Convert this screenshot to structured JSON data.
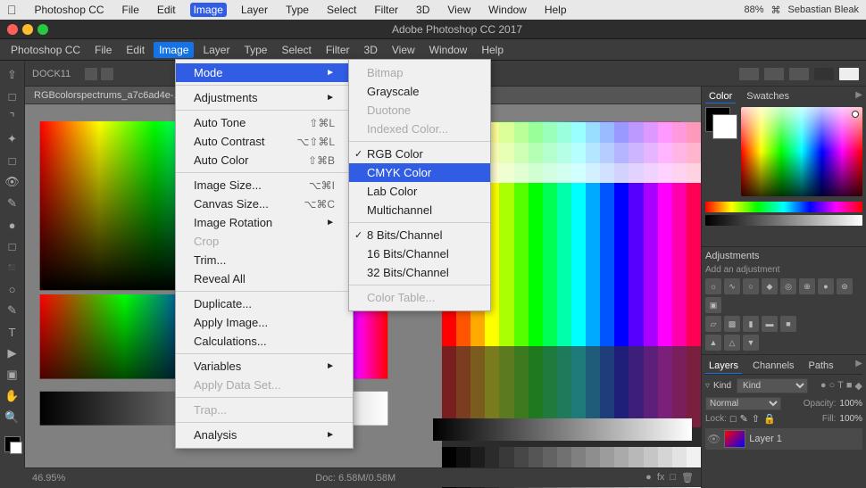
{
  "os": {
    "menubar": {
      "apple": "⌘",
      "items": [
        "Photoshop CC",
        "File",
        "Edit",
        "Image",
        "Layer",
        "Type",
        "Select",
        "Filter",
        "3D",
        "View",
        "Window",
        "Help"
      ],
      "active_item": "Image",
      "right": {
        "battery": "88%",
        "wifi": "WiFi",
        "user": "Sebastian Bleak",
        "time": ""
      }
    }
  },
  "ps": {
    "title": "Adobe Photoshop CC 2017",
    "tab": "RGBcolorspectrums_a7c6ad4e-...",
    "zoom": "46.95%",
    "doc_size": "Doc: 6.58M/0.58M",
    "options_bar": {
      "dock_label": "DOCK11"
    }
  },
  "image_menu": {
    "items": [
      {
        "label": "Mode",
        "shortcut": "",
        "has_submenu": true,
        "highlighted": true
      },
      {
        "separator": true
      },
      {
        "label": "Adjustments",
        "shortcut": "",
        "has_submenu": true
      },
      {
        "separator": true
      },
      {
        "label": "Auto Tone",
        "shortcut": "⇧⌘L"
      },
      {
        "label": "Auto Contrast",
        "shortcut": "⌥⇧⌘L"
      },
      {
        "label": "Auto Color",
        "shortcut": "⇧⌘B"
      },
      {
        "separator": true
      },
      {
        "label": "Image Size...",
        "shortcut": "⌥⌘I"
      },
      {
        "label": "Canvas Size...",
        "shortcut": "⌥⌘C"
      },
      {
        "label": "Image Rotation",
        "shortcut": "",
        "has_submenu": true
      },
      {
        "label": "Crop",
        "shortcut": "",
        "disabled": true
      },
      {
        "label": "Trim...",
        "shortcut": ""
      },
      {
        "label": "Reveal All",
        "shortcut": ""
      },
      {
        "separator": true
      },
      {
        "label": "Duplicate...",
        "shortcut": ""
      },
      {
        "label": "Apply Image...",
        "shortcut": ""
      },
      {
        "label": "Calculations...",
        "shortcut": ""
      },
      {
        "separator": true
      },
      {
        "label": "Variables",
        "shortcut": "",
        "has_submenu": true
      },
      {
        "label": "Apply Data Set...",
        "shortcut": "",
        "disabled": true
      },
      {
        "separator": true
      },
      {
        "label": "Trap...",
        "shortcut": "",
        "disabled": true
      },
      {
        "separator": true
      },
      {
        "label": "Analysis",
        "shortcut": "",
        "has_submenu": true
      }
    ]
  },
  "mode_submenu": {
    "items": [
      {
        "label": "Bitmap",
        "disabled": true
      },
      {
        "label": "Grayscale"
      },
      {
        "label": "Duotone",
        "disabled": true
      },
      {
        "label": "Indexed Color...",
        "disabled": true
      },
      {
        "separator": true
      },
      {
        "label": "RGB Color",
        "checked": true
      },
      {
        "label": "CMYK Color",
        "highlighted": true
      },
      {
        "label": "Lab Color"
      },
      {
        "label": "Multichannel"
      },
      {
        "separator": true
      },
      {
        "label": "8 Bits/Channel",
        "checked": true
      },
      {
        "label": "16 Bits/Channel"
      },
      {
        "label": "32 Bits/Channel"
      },
      {
        "separator": true
      },
      {
        "label": "Color Table...",
        "disabled": true
      }
    ]
  },
  "panels": {
    "color_tabs": [
      "Color",
      "Swatches"
    ],
    "active_color_tab": "Color",
    "adjustments_label": "Adjustments",
    "adjustments_sublabel": "Add an adjustment",
    "layers_tabs": [
      "Layers",
      "Channels",
      "Paths"
    ],
    "active_layers_tab": "Layers",
    "blend_mode": "Normal",
    "opacity": "100%",
    "fill": "100%",
    "lock_label": "Lock:",
    "layer_name": "Layer 1",
    "filter_label": "Kind"
  }
}
